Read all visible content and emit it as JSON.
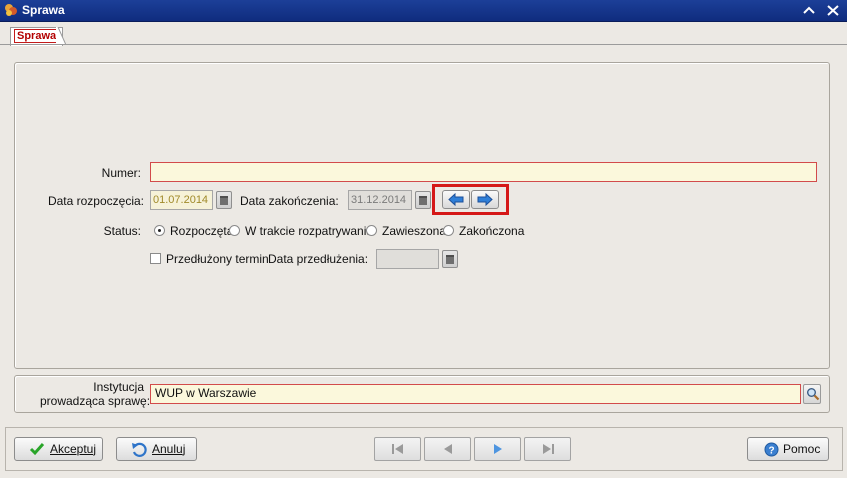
{
  "window": {
    "title": "Sprawa",
    "minimize_label": "⌃",
    "close_label": "✕"
  },
  "tabs": [
    {
      "label": "Sprawa",
      "active": true
    }
  ],
  "form": {
    "numer_label": "Numer:",
    "numer_value": "",
    "data_rozpoczecia_label": "Data rozpoczęcia:",
    "data_rozpoczecia_value": "01.07.2014",
    "data_zakonczenia_label": "Data zakończenia:",
    "data_zakonczenia_value": "31.12.2014",
    "status_label": "Status:",
    "status_options": [
      {
        "label": "Rozpoczęta",
        "checked": true
      },
      {
        "label": "W trakcie rozpatrywania",
        "checked": false
      },
      {
        "label": "Zawieszona",
        "checked": false
      },
      {
        "label": "Zakończona",
        "checked": false
      }
    ],
    "przedluzony_label": "Przedłużony termin",
    "przedluzony_checked": false,
    "data_przedluzenia_label": "Data przedłużenia:",
    "data_przedluzenia_value": ""
  },
  "institution": {
    "label_line1": "Instytucja",
    "label_line2": "prowadząca sprawę:",
    "value": "WUP w Warszawie"
  },
  "footer": {
    "accept_label": "Akceptuj",
    "cancel_label": "Anuluj",
    "help_label": "Pomoc"
  },
  "colors": {
    "titlebar": "#13348a",
    "required_border": "#d24b4b",
    "input_bg": "#fbf8dc",
    "highlight": "#d51818",
    "arrow_blue": "#2f7fd8"
  }
}
